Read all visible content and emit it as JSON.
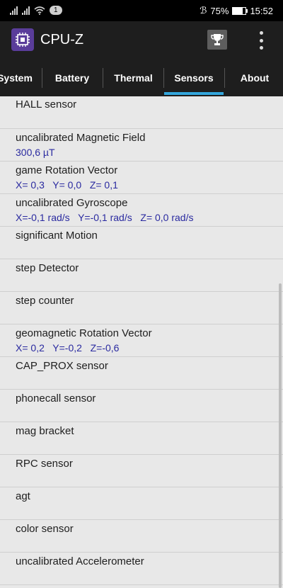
{
  "status_bar": {
    "notification_count": "1",
    "battery_percent": "75%",
    "battery_level": 0.75,
    "time": "15:52"
  },
  "app_bar": {
    "title": "CPU-Z",
    "icons": {
      "app": "cpu-chip-icon",
      "trophy": "trophy-icon",
      "menu": "overflow-menu-icon"
    }
  },
  "tabs": [
    {
      "label": "System"
    },
    {
      "label": "Battery"
    },
    {
      "label": "Thermal"
    },
    {
      "label": "Sensors"
    },
    {
      "label": "About"
    }
  ],
  "active_tab": "Sensors",
  "sensors": [
    {
      "name": "HALL sensor",
      "value": ""
    },
    {
      "name": "uncalibrated Magnetic Field",
      "value": "300,6 µT"
    },
    {
      "name": "game Rotation Vector",
      "value": "X= 0,3   Y= 0,0   Z= 0,1"
    },
    {
      "name": "uncalibrated Gyroscope",
      "value": "X=-0,1 rad/s   Y=-0,1 rad/s   Z= 0,0 rad/s"
    },
    {
      "name": "significant Motion",
      "value": ""
    },
    {
      "name": "step Detector",
      "value": ""
    },
    {
      "name": "step counter",
      "value": ""
    },
    {
      "name": "geomagnetic Rotation Vector",
      "value": "X= 0,2   Y=-0,2   Z=-0,6"
    },
    {
      "name": "CAP_PROX sensor",
      "value": ""
    },
    {
      "name": "phonecall sensor",
      "value": ""
    },
    {
      "name": "mag bracket",
      "value": ""
    },
    {
      "name": "RPC sensor",
      "value": ""
    },
    {
      "name": "agt",
      "value": ""
    },
    {
      "name": "color sensor",
      "value": ""
    },
    {
      "name": "uncalibrated Accelerometer",
      "value": ""
    }
  ],
  "colors": {
    "accent": "#33a6dc",
    "value_text": "#2a2aa0",
    "app_icon_bg": "#5a3d9a",
    "toolbar_bg": "#1e1e1e",
    "list_bg": "#e8e8e8"
  }
}
